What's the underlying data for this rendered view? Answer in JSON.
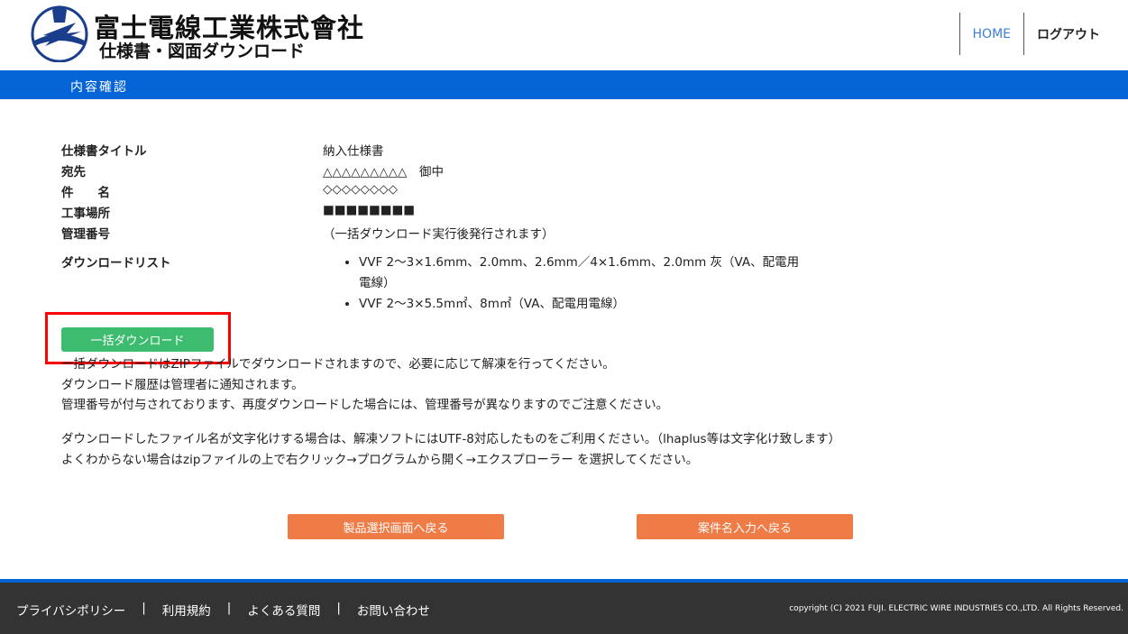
{
  "header": {
    "company_name": "富士電線工業株式會社",
    "site_subtitle": "仕様書・図面ダウンロード",
    "nav": {
      "home": "HOME",
      "logout": "ログアウト"
    }
  },
  "page": {
    "title": "内容確認"
  },
  "details": {
    "spec_title_label": "仕様書タイトル",
    "spec_title_value": "納入仕様書",
    "recipient_label": "宛先",
    "recipient_value": "△△△△△△△△△　御中",
    "subject_label": "件　　名",
    "subject_value": "◇◇◇◇◇◇◇◇",
    "site_label": "工事場所",
    "site_value": "■■■■■■■■",
    "mgmt_label": "管理番号",
    "mgmt_value": "（一括ダウンロード実行後発行されます）",
    "download_list_label": "ダウンロードリスト",
    "download_list": [
      "VVF 2～3×1.6mm、2.0mm、2.6mm／4×1.6mm、2.0mm 灰（VA、配電用電線）",
      "VVF 2～3×5.5m㎡、8m㎡（VA、配電用電線）"
    ]
  },
  "actions": {
    "bulk_download": "一括ダウンロード",
    "back_to_product": "製品選択画面へ戻る",
    "back_to_project": "案件名入力へ戻る"
  },
  "notes": [
    "一括ダウンロードはZIPファイルでダウンロードされますので、必要に応じて解凍を行ってください。",
    "ダウンロード履歴は管理者に通知されます。",
    "管理番号が付与されております、再度ダウンロードした場合には、管理番号が異なりますのでご注意ください。"
  ],
  "notes2": [
    "ダウンロードしたファイル名が文字化けする場合は、解凍ソフトにはUTF-8対応したものをご利用ください。（lhaplus等は文字化け致します）",
    "よくわからない場合はzipファイルの上で右クリック→プログラムから開く→エクスプローラー を選択してください。"
  ],
  "footer": {
    "links": [
      "プライバシポリシー",
      "利用規約",
      "よくある質問",
      "お問い合わせ"
    ],
    "separator": "|",
    "copyright": "copyright (C) 2021 FUJI. ELECTRIC WIRE INDUSTRIES CO.,LTD. All Rights Reserved."
  },
  "colors": {
    "primary_blue": "#0564d6",
    "download_green": "#3dbb6e",
    "back_orange": "#ef7c46",
    "highlight_red": "#ff0000",
    "footer_bg": "#333333"
  },
  "icons": {
    "logo": "company-logo-icon"
  }
}
